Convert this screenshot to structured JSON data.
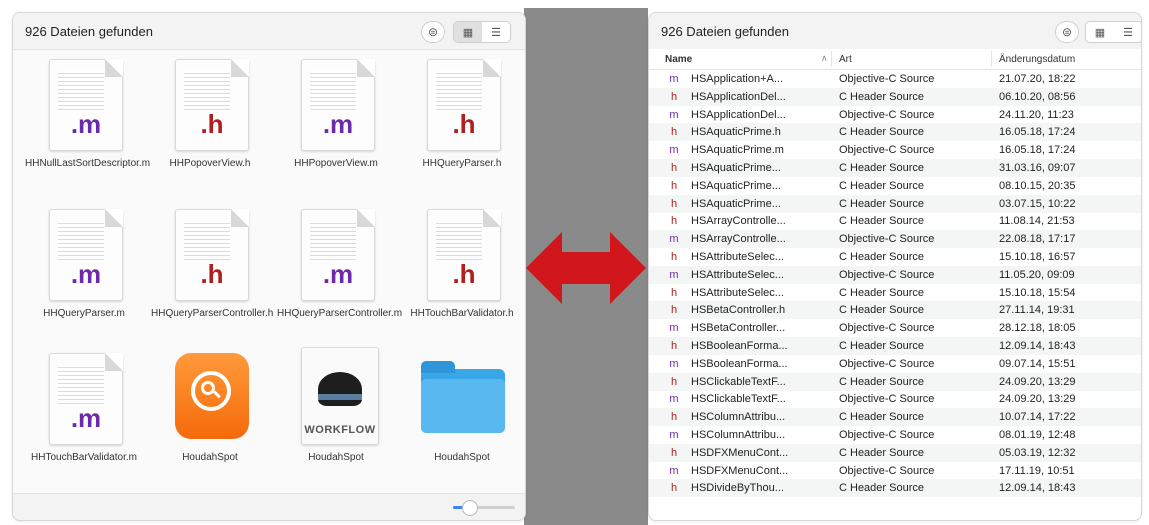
{
  "left": {
    "count_label": "926 Dateien gefunden",
    "items": [
      {
        "label": "HHNullLastSortDescriptor.m",
        "type": "m-doc",
        "ext": ".m"
      },
      {
        "label": "HHPopoverView.h",
        "type": "h-doc",
        "ext": ".h"
      },
      {
        "label": "HHPopoverView.m",
        "type": "m-doc",
        "ext": ".m"
      },
      {
        "label": "HHQueryParser.h",
        "type": "h-doc",
        "ext": ".h"
      },
      {
        "label": "HHQueryParser.m",
        "type": "m-doc",
        "ext": ".m"
      },
      {
        "label": "HHQueryParserController.h",
        "type": "h-doc",
        "ext": ".h"
      },
      {
        "label": "HHQueryParserController.m",
        "type": "m-doc",
        "ext": ".m"
      },
      {
        "label": "HHTouchBarValidator.h",
        "type": "h-doc",
        "ext": ".h"
      },
      {
        "label": "HHTouchBarValidator.m",
        "type": "m-doc",
        "ext": ".m"
      },
      {
        "label": "HoudahSpot",
        "type": "app-icon",
        "ext": ""
      },
      {
        "label": "HoudahSpot",
        "type": "workflow-icon",
        "ext": "WORKFLOW"
      },
      {
        "label": "HoudahSpot",
        "type": "folder-icon",
        "ext": ""
      }
    ],
    "icon_size_fraction": 0.25
  },
  "right": {
    "count_label": "926 Dateien gefunden",
    "columns": {
      "name": "Name",
      "kind": "Art",
      "date": "Änderungsdatum"
    },
    "rows": [
      {
        "icon": "m",
        "name": "HSApplication+A...",
        "kind": "Objective-C Source",
        "date": "21.07.20, 18:22"
      },
      {
        "icon": "h",
        "name": "HSApplicationDel...",
        "kind": "C Header Source",
        "date": "06.10.20, 08:56"
      },
      {
        "icon": "m",
        "name": "HSApplicationDel...",
        "kind": "Objective-C Source",
        "date": "24.11.20, 11:23"
      },
      {
        "icon": "h",
        "name": "HSAquaticPrime.h",
        "kind": "C Header Source",
        "date": "16.05.18, 17:24"
      },
      {
        "icon": "m",
        "name": "HSAquaticPrime.m",
        "kind": "Objective-C Source",
        "date": "16.05.18, 17:24"
      },
      {
        "icon": "h",
        "name": "HSAquaticPrime...",
        "kind": "C Header Source",
        "date": "31.03.16, 09:07"
      },
      {
        "icon": "h",
        "name": "HSAquaticPrime...",
        "kind": "C Header Source",
        "date": "08.10.15, 20:35"
      },
      {
        "icon": "h",
        "name": "HSAquaticPrime...",
        "kind": "C Header Source",
        "date": "03.07.15, 10:22"
      },
      {
        "icon": "h",
        "name": "HSArrayControlle...",
        "kind": "C Header Source",
        "date": "11.08.14, 21:53"
      },
      {
        "icon": "m",
        "name": "HSArrayControlle...",
        "kind": "Objective-C Source",
        "date": "22.08.18, 17:17"
      },
      {
        "icon": "h",
        "name": "HSAttributeSelec...",
        "kind": "C Header Source",
        "date": "15.10.18, 16:57"
      },
      {
        "icon": "m",
        "name": "HSAttributeSelec...",
        "kind": "Objective-C Source",
        "date": "11.05.20, 09:09"
      },
      {
        "icon": "h",
        "name": "HSAttributeSelec...",
        "kind": "C Header Source",
        "date": "15.10.18, 15:54"
      },
      {
        "icon": "h",
        "name": "HSBetaController.h",
        "kind": "C Header Source",
        "date": "27.11.14, 19:31"
      },
      {
        "icon": "m",
        "name": "HSBetaController...",
        "kind": "Objective-C Source",
        "date": "28.12.18, 18:05"
      },
      {
        "icon": "h",
        "name": "HSBooleanForma...",
        "kind": "C Header Source",
        "date": "12.09.14, 18:43"
      },
      {
        "icon": "m",
        "name": "HSBooleanForma...",
        "kind": "Objective-C Source",
        "date": "09.07.14, 15:51"
      },
      {
        "icon": "h",
        "name": "HSClickableTextF...",
        "kind": "C Header Source",
        "date": "24.09.20, 13:29"
      },
      {
        "icon": "m",
        "name": "HSClickableTextF...",
        "kind": "Objective-C Source",
        "date": "24.09.20, 13:29"
      },
      {
        "icon": "h",
        "name": "HSColumnAttribu...",
        "kind": "C Header Source",
        "date": "10.07.14, 17:22"
      },
      {
        "icon": "m",
        "name": "HSColumnAttribu...",
        "kind": "Objective-C Source",
        "date": "08.01.19, 12:48"
      },
      {
        "icon": "h",
        "name": "HSDFXMenuCont...",
        "kind": "C Header Source",
        "date": "05.03.19, 12:32"
      },
      {
        "icon": "m",
        "name": "HSDFXMenuCont...",
        "kind": "Objective-C Source",
        "date": "17.11.19, 10:51"
      },
      {
        "icon": "h",
        "name": "HSDivideByThou...",
        "kind": "C Header Source",
        "date": "12.09.14, 18:43"
      }
    ]
  },
  "colors": {
    "accent": "#3b82f6",
    "arrow": "#d0161b",
    "m_ext": "#6d2aa8",
    "h_ext": "#b01e1e"
  }
}
